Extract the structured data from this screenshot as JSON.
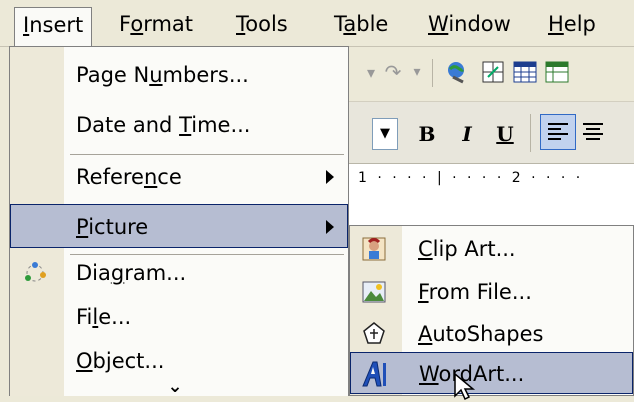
{
  "menubar": {
    "items": [
      {
        "label": "Insert",
        "mnemonic_index": 0,
        "active": true
      },
      {
        "label": "Format",
        "mnemonic_index": 1
      },
      {
        "label": "Tools",
        "mnemonic_index": 0
      },
      {
        "label": "Table",
        "mnemonic_index": 1
      },
      {
        "label": "Window",
        "mnemonic_index": 0
      },
      {
        "label": "Help",
        "mnemonic_index": 0
      }
    ]
  },
  "toolbar": {
    "format_buttons": [
      "B",
      "I",
      "U"
    ]
  },
  "ruler": {
    "ticks": "1 · · · · | · · · · 2 · · · ·"
  },
  "insert_menu": {
    "items": [
      {
        "label": "Page Numbers...",
        "mnemonic": "u"
      },
      {
        "label": "Date and Time...",
        "mnemonic": "T"
      },
      {
        "label": "Reference",
        "mnemonic": "n",
        "submenu": true
      },
      {
        "label": "Picture",
        "mnemonic": "P",
        "submenu": true,
        "highlighted": true
      },
      {
        "label": "Diagram...",
        "mnemonic": "g",
        "icon": "diagram-icon"
      },
      {
        "label": "File...",
        "mnemonic": "l"
      },
      {
        "label": "Object...",
        "mnemonic": "O"
      }
    ],
    "expand_icon": "double-chevron-down-icon"
  },
  "picture_menu": {
    "items": [
      {
        "label": "Clip Art...",
        "mnemonic": "C",
        "icon": "clip-art-icon"
      },
      {
        "label": "From File...",
        "mnemonic": "F",
        "icon": "picture-from-file-icon"
      },
      {
        "label": "AutoShapes",
        "mnemonic": "A",
        "icon": "autoshapes-icon"
      },
      {
        "label": "WordArt...",
        "mnemonic": "W",
        "icon": "wordart-icon",
        "highlighted": true
      }
    ]
  },
  "colors": {
    "menu_bg": "#fbfbf8",
    "gutter": "#ede9d9",
    "highlight": "#b6bdd2",
    "highlight_border": "#0a246a"
  }
}
